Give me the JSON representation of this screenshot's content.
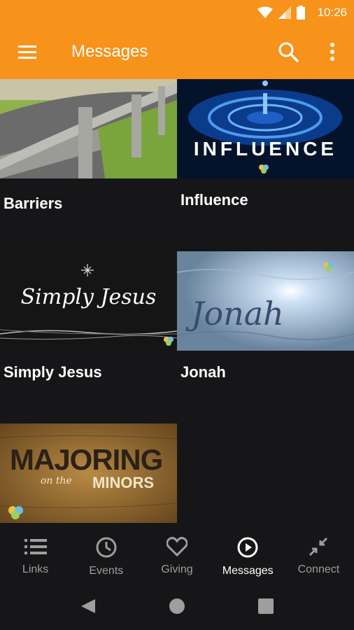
{
  "status_bar": {
    "time": "10:26"
  },
  "app_bar": {
    "title": "Messages"
  },
  "messages": [
    {
      "label": "Barriers"
    },
    {
      "label": "Influence",
      "thumb_text": "INFLUENCE"
    },
    {
      "label": "Simply Jesus",
      "thumb_text": "Simply Jesus"
    },
    {
      "label": "Jonah",
      "thumb_text": "Jonah"
    },
    {
      "label": "",
      "thumb_text_main": "MAJORING",
      "thumb_text_small": "on the",
      "thumb_text_sub": "MINORS"
    }
  ],
  "bottom_nav": {
    "items": [
      {
        "label": "Links",
        "icon": "list-icon"
      },
      {
        "label": "Events",
        "icon": "clock-icon"
      },
      {
        "label": "Giving",
        "icon": "heart-icon"
      },
      {
        "label": "Messages",
        "icon": "play-circle-icon",
        "active": true
      },
      {
        "label": "Connect",
        "icon": "collapse-icon"
      }
    ]
  },
  "colors": {
    "accent": "#f7931a",
    "background": "#161618",
    "inactive": "#9e9e9e",
    "active": "#ffffff"
  }
}
